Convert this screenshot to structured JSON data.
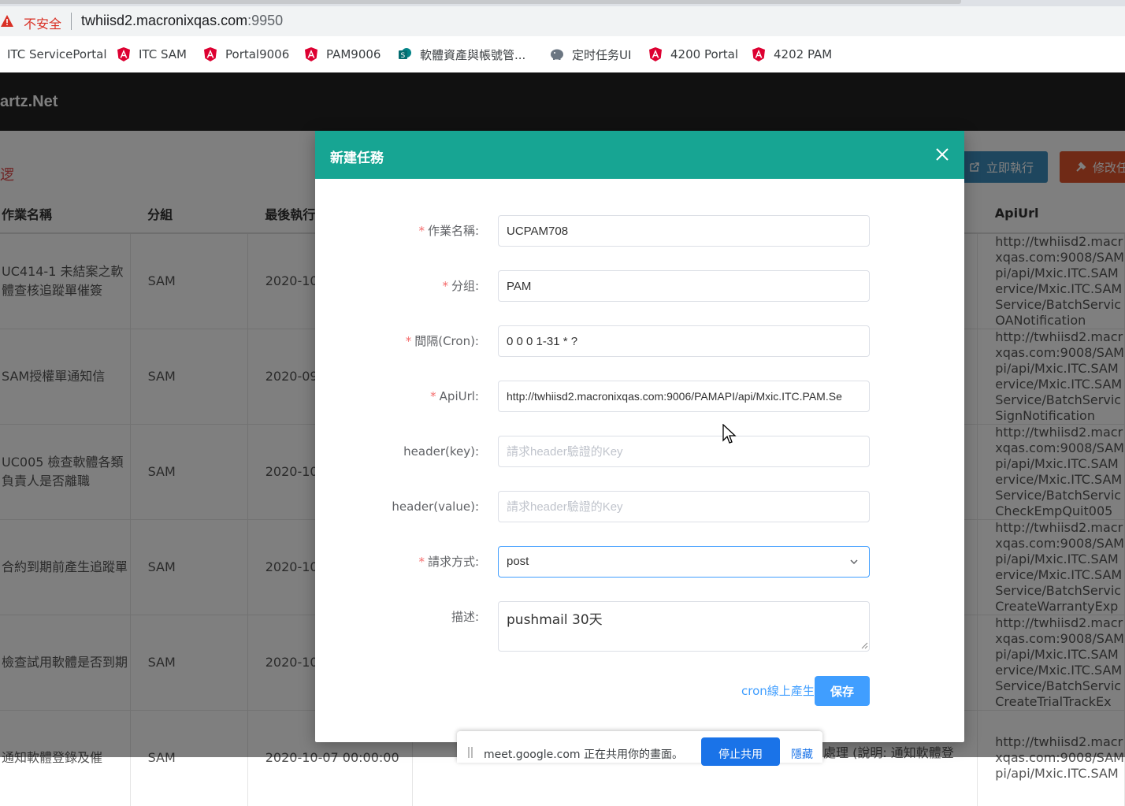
{
  "browser": {
    "insecure_label": "不安全",
    "url_host": "twhiisd2.macronixqas.com",
    "url_port": ":9950",
    "bookmarks": [
      {
        "label": "ITC ServicePortal",
        "icon": "none"
      },
      {
        "label": "ITC SAM",
        "icon": "angular-icon"
      },
      {
        "label": "Portal9006",
        "icon": "angular-icon"
      },
      {
        "label": "PAM9006",
        "icon": "angular-icon"
      },
      {
        "label": "軟體資產與帳號管...",
        "icon": "sharepoint-icon"
      },
      {
        "label": "定时任务UI",
        "icon": "elephant-icon"
      },
      {
        "label": "4200 Portal",
        "icon": "angular-icon"
      },
      {
        "label": "4202 PAM",
        "icon": "angular-icon"
      }
    ]
  },
  "page": {
    "brand": "artz.Net",
    "red_mark": "逻",
    "run_now_button": "立即執行",
    "edit_button": "修改任",
    "table": {
      "headers": [
        "作業名稱",
        "分組",
        "最後執行",
        "ApiUrl"
      ],
      "rows": [
        {
          "name": "UC414-1 未結案之軟體查核追蹤單催簽",
          "group": "SAM",
          "time": "2020-10",
          "api": [
            "http://twhiisd2.macr",
            "xqas.com:9008/SAM",
            "pi/api/Mxic.ITC.SAM",
            "ervice/Mxic.ITC.SAM",
            "Service/BatchServic",
            "OANotification"
          ]
        },
        {
          "name": "SAM授權單通知信",
          "group": "SAM",
          "time": "2020-09",
          "api": [
            "http://twhiisd2.macr",
            "xqas.com:9008/SAM",
            "pi/api/Mxic.ITC.SAM",
            "ervice/Mxic.ITC.SAM",
            "Service/BatchServic",
            "SignNotification"
          ]
        },
        {
          "name": "UC005 檢查軟體各類負責人是否離職",
          "group": "SAM",
          "time": "2020-10",
          "api": [
            "http://twhiisd2.macr",
            "xqas.com:9008/SAM",
            "pi/api/Mxic.ITC.SAM",
            "ervice/Mxic.ITC.SAM",
            "Service/BatchServic",
            "CheckEmpQuit005"
          ]
        },
        {
          "name": "合約到期前產生追蹤單",
          "group": "SAM",
          "time": "2020-10",
          "api": [
            "http://twhiisd2.macr",
            "xqas.com:9008/SAM",
            "pi/api/Mxic.ITC.SAM",
            "ervice/Mxic.ITC.SAM",
            "Service/BatchServic",
            "CreateWarrantyExp"
          ]
        },
        {
          "name": "檢查試用軟體是否到期",
          "group": "SAM",
          "time": "2020-10",
          "api": [
            "http://twhiisd2.macr",
            "xqas.com:9008/SAM",
            "pi/api/Mxic.ITC.SAM",
            "ervice/Mxic.ITC.SAM",
            "Service/BatchServic",
            "CreateTrialTrackEx"
          ]
        },
        {
          "name": "通知軟體登錄及催",
          "group": "SAM",
          "time": "2020-10-07 00:00:00",
          "api": [
            "http://twhiisd2.macr",
            "xqas.com:9008/SAM",
            "pi/api/Mxic.ITC.SAM"
          ]
        }
      ],
      "partial_description": "處理 (說明: 通知軟體登"
    }
  },
  "modal": {
    "title": "新建任務",
    "fields": [
      {
        "label": "作業名稱:",
        "required": true,
        "value": "UCPAM708",
        "placeholder": ""
      },
      {
        "label": "分组:",
        "required": true,
        "value": "PAM",
        "placeholder": ""
      },
      {
        "label": "間隔(Cron):",
        "required": true,
        "value": "0 0 0 1-31 * ?",
        "placeholder": ""
      },
      {
        "label": "ApiUrl:",
        "required": true,
        "value": "http://twhiisd2.macronixqas.com:9006/PAMAPI/api/Mxic.ITC.PAM.Se",
        "placeholder": ""
      },
      {
        "label": "header(key):",
        "required": false,
        "value": "",
        "placeholder": "請求header驗證的Key"
      },
      {
        "label": "header(value):",
        "required": false,
        "value": "",
        "placeholder": "請求header驗證的Key"
      }
    ],
    "method": {
      "label": "請求方式:",
      "required": true,
      "value": "post"
    },
    "description": {
      "label": "描述:",
      "value": "pushmail 30天"
    },
    "cron_link": "cron線上產生",
    "save_button": "保存"
  },
  "meet_banner": {
    "text": "meet.google.com 正在共用你的畫面。",
    "stop_button": "停止共用",
    "hide_link": "隱藏"
  },
  "colors": {
    "modal_header": "#17a593",
    "primary": "#409eff",
    "required_star": "#f56c6c",
    "run_button": "#3c8dbc",
    "edit_button": "#e0542d",
    "page_header": "#222222"
  }
}
